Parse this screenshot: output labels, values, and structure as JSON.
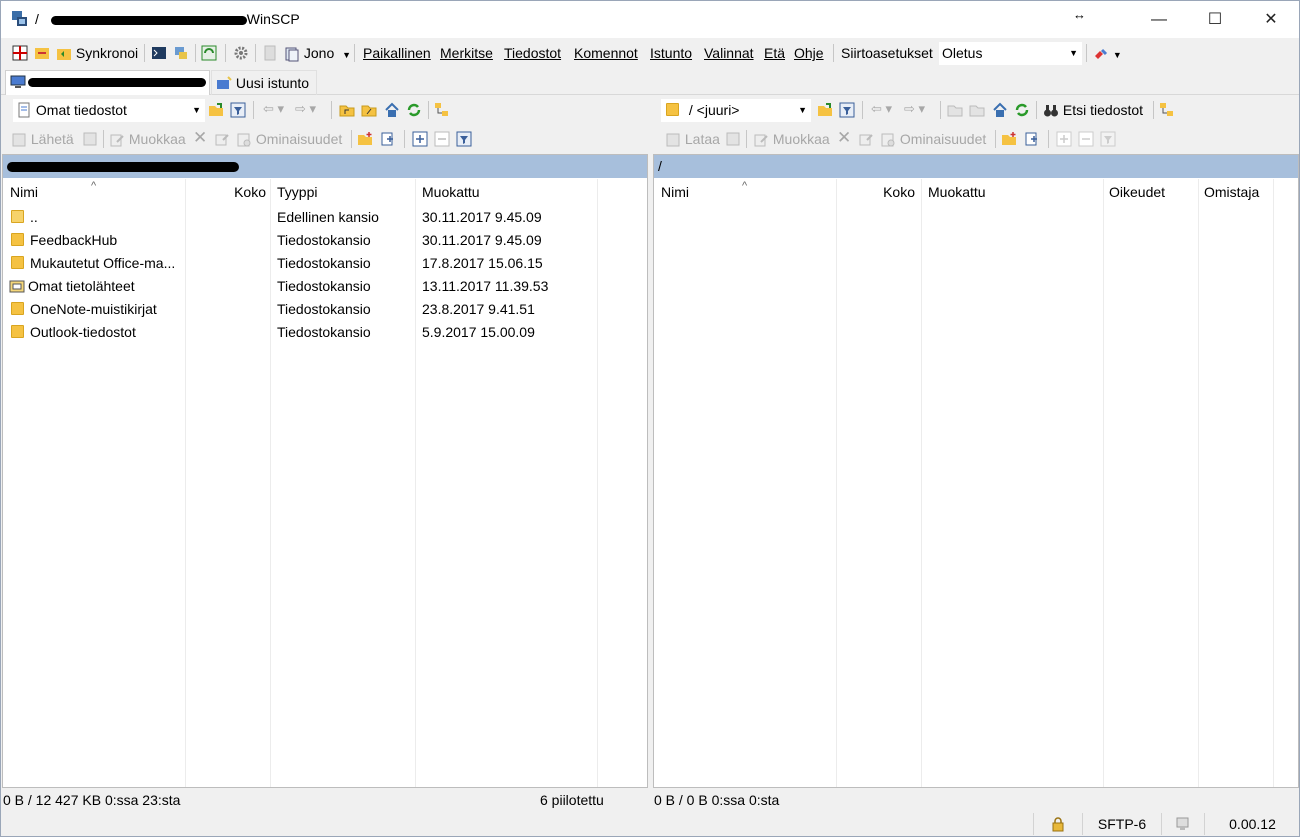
{
  "window": {
    "title_prefix": "/",
    "title_suffix": "WinSCP",
    "resize_indicator": "↔",
    "minimize": "—",
    "maximize": "☐",
    "close": "✕"
  },
  "menubar": {
    "synkronoi": "Synkronoi",
    "jono": "Jono",
    "menus": [
      "Paikallinen",
      "Merkitse",
      "Tiedostot",
      "Komennot",
      "Istunto",
      "Valinnat",
      "Etä",
      "Ohje"
    ],
    "transfer_label": "Siirtoasetukset",
    "transfer_value": "Oletus"
  },
  "tabs": {
    "new_session": "Uusi istunto"
  },
  "local": {
    "location": "Omat tiedostot",
    "actions": {
      "send": "Lähetä",
      "edit": "Muokkaa",
      "properties": "Ominaisuudet"
    },
    "columns": [
      "Nimi",
      "Koko",
      "Tyyppi",
      "Muokattu"
    ],
    "files": [
      {
        "name": "..",
        "size": "",
        "type": "Edellinen kansio",
        "modified": "30.11.2017  9.45.09",
        "icon": "parent-folder"
      },
      {
        "name": "FeedbackHub",
        "size": "",
        "type": "Tiedostokansio",
        "modified": "30.11.2017  9.45.09",
        "icon": "folder"
      },
      {
        "name": "Mukautetut Office-ma...",
        "size": "",
        "type": "Tiedostokansio",
        "modified": "17.8.2017  15.06.15",
        "icon": "folder"
      },
      {
        "name": "Omat tietolähteet",
        "size": "",
        "type": "Tiedostokansio",
        "modified": "13.11.2017  11.39.53",
        "icon": "datasource-folder"
      },
      {
        "name": "OneNote-muistikirjat",
        "size": "",
        "type": "Tiedostokansio",
        "modified": "23.8.2017  9.41.51",
        "icon": "folder"
      },
      {
        "name": "Outlook-tiedostot",
        "size": "",
        "type": "Tiedostokansio",
        "modified": "5.9.2017  15.00.09",
        "icon": "folder"
      }
    ],
    "status": "0 B / 12 427 KB 0:ssa 23:sta",
    "hidden": "6 piilotettu"
  },
  "remote": {
    "location": "/ <juuri>",
    "find_files": "Etsi tiedostot",
    "actions": {
      "download": "Lataa",
      "edit": "Muokkaa",
      "properties": "Ominaisuudet"
    },
    "path": "/",
    "columns": [
      "Nimi",
      "Koko",
      "Muokattu",
      "Oikeudet",
      "Omistaja"
    ],
    "status": "0 B / 0 B 0:ssa 0:sta"
  },
  "statusbar": {
    "protocol": "SFTP-6",
    "time": "0.00.12"
  },
  "colors": {
    "path_bar": "#a7bfdc",
    "folder": "#f5c242",
    "chrome": "#f0f0f0"
  }
}
